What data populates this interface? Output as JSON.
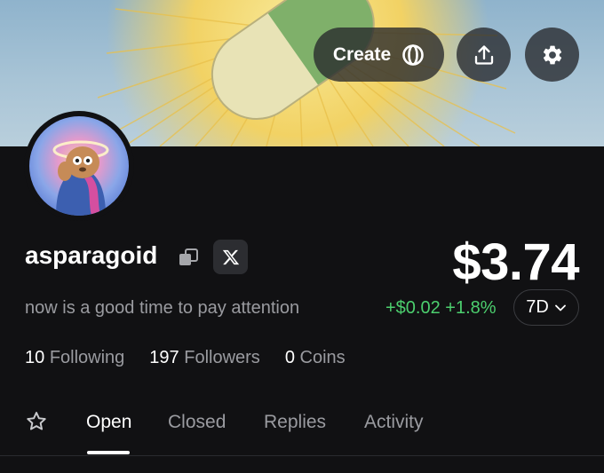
{
  "header": {
    "create_label": "Create",
    "create_icon": "coin-ring-icon",
    "share_icon": "share-upload-icon",
    "settings_icon": "gear-icon"
  },
  "profile": {
    "username": "asparagoid",
    "bio": "now is a good time to pay attention",
    "copy_icon": "copy-icon",
    "x_icon": "x-logo-icon"
  },
  "balance": {
    "amount": "$3.74",
    "change": "+$0.02 +1.8%",
    "period": "7D",
    "change_color": "#4ccf6e"
  },
  "stats": [
    {
      "count": "10",
      "label": "Following"
    },
    {
      "count": "197",
      "label": "Followers"
    },
    {
      "count": "0",
      "label": "Coins"
    }
  ],
  "tabs": [
    {
      "label": "Open",
      "active": true
    },
    {
      "label": "Closed",
      "active": false
    },
    {
      "label": "Replies",
      "active": false
    },
    {
      "label": "Activity",
      "active": false
    }
  ]
}
